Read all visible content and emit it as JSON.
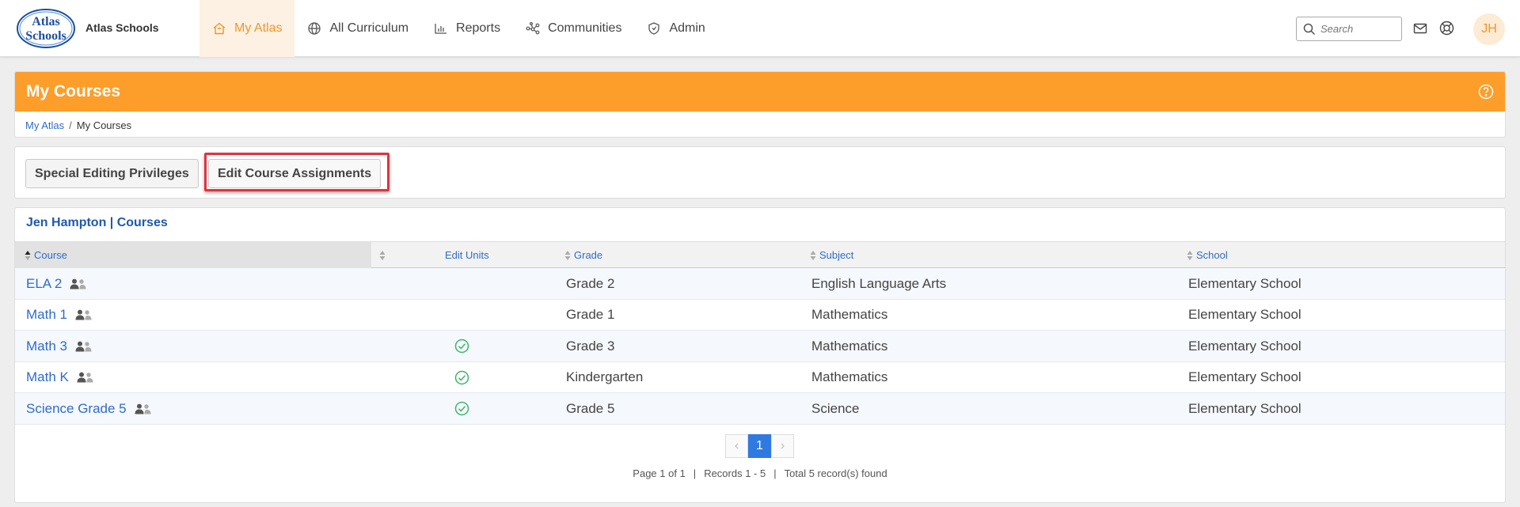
{
  "app": {
    "school_name": "Atlas Schools",
    "logo_text_line1": "Atlas",
    "logo_text_line2": "Schools"
  },
  "nav": {
    "items": [
      {
        "label": "My Atlas",
        "icon": "home-icon",
        "active": true
      },
      {
        "label": "All Curriculum",
        "icon": "globe-icon",
        "active": false
      },
      {
        "label": "Reports",
        "icon": "bar-chart-icon",
        "active": false
      },
      {
        "label": "Communities",
        "icon": "network-icon",
        "active": false
      },
      {
        "label": "Admin",
        "icon": "shield-icon",
        "active": false
      }
    ],
    "search_placeholder": "Search",
    "avatar_initials": "JH"
  },
  "page": {
    "title": "My Courses",
    "breadcrumb": [
      {
        "label": "My Atlas",
        "link": true
      },
      {
        "label": "My Courses",
        "link": false
      }
    ]
  },
  "actions": {
    "special_editing": "Special Editing Privileges",
    "edit_assignments": "Edit Course Assignments"
  },
  "courses": {
    "title": "Jen Hampton | Courses",
    "columns": {
      "course": "Course",
      "edit_units": "Edit Units",
      "grade": "Grade",
      "subject": "Subject",
      "school": "School"
    },
    "rows": [
      {
        "course": "ELA 2",
        "edit_units": false,
        "grade": "Grade 2",
        "subject": "English Language Arts",
        "school": "Elementary School"
      },
      {
        "course": "Math 1",
        "edit_units": false,
        "grade": "Grade 1",
        "subject": "Mathematics",
        "school": "Elementary School"
      },
      {
        "course": "Math 3",
        "edit_units": true,
        "grade": "Grade 3",
        "subject": "Mathematics",
        "school": "Elementary School"
      },
      {
        "course": "Math K",
        "edit_units": true,
        "grade": "Kindergarten",
        "subject": "Mathematics",
        "school": "Elementary School"
      },
      {
        "course": "Science Grade 5",
        "edit_units": true,
        "grade": "Grade 5",
        "subject": "Science",
        "school": "Elementary School"
      }
    ],
    "pagination": {
      "current_page": "1",
      "page_info": "Page 1 of 1",
      "records": "Records 1 - 5",
      "total": "Total 5 record(s) found"
    }
  },
  "colors": {
    "accent_orange": "#fd9e2a",
    "link_blue": "#2f6cc8",
    "check_green": "#3bb56a",
    "highlight_red": "#e0333f"
  }
}
